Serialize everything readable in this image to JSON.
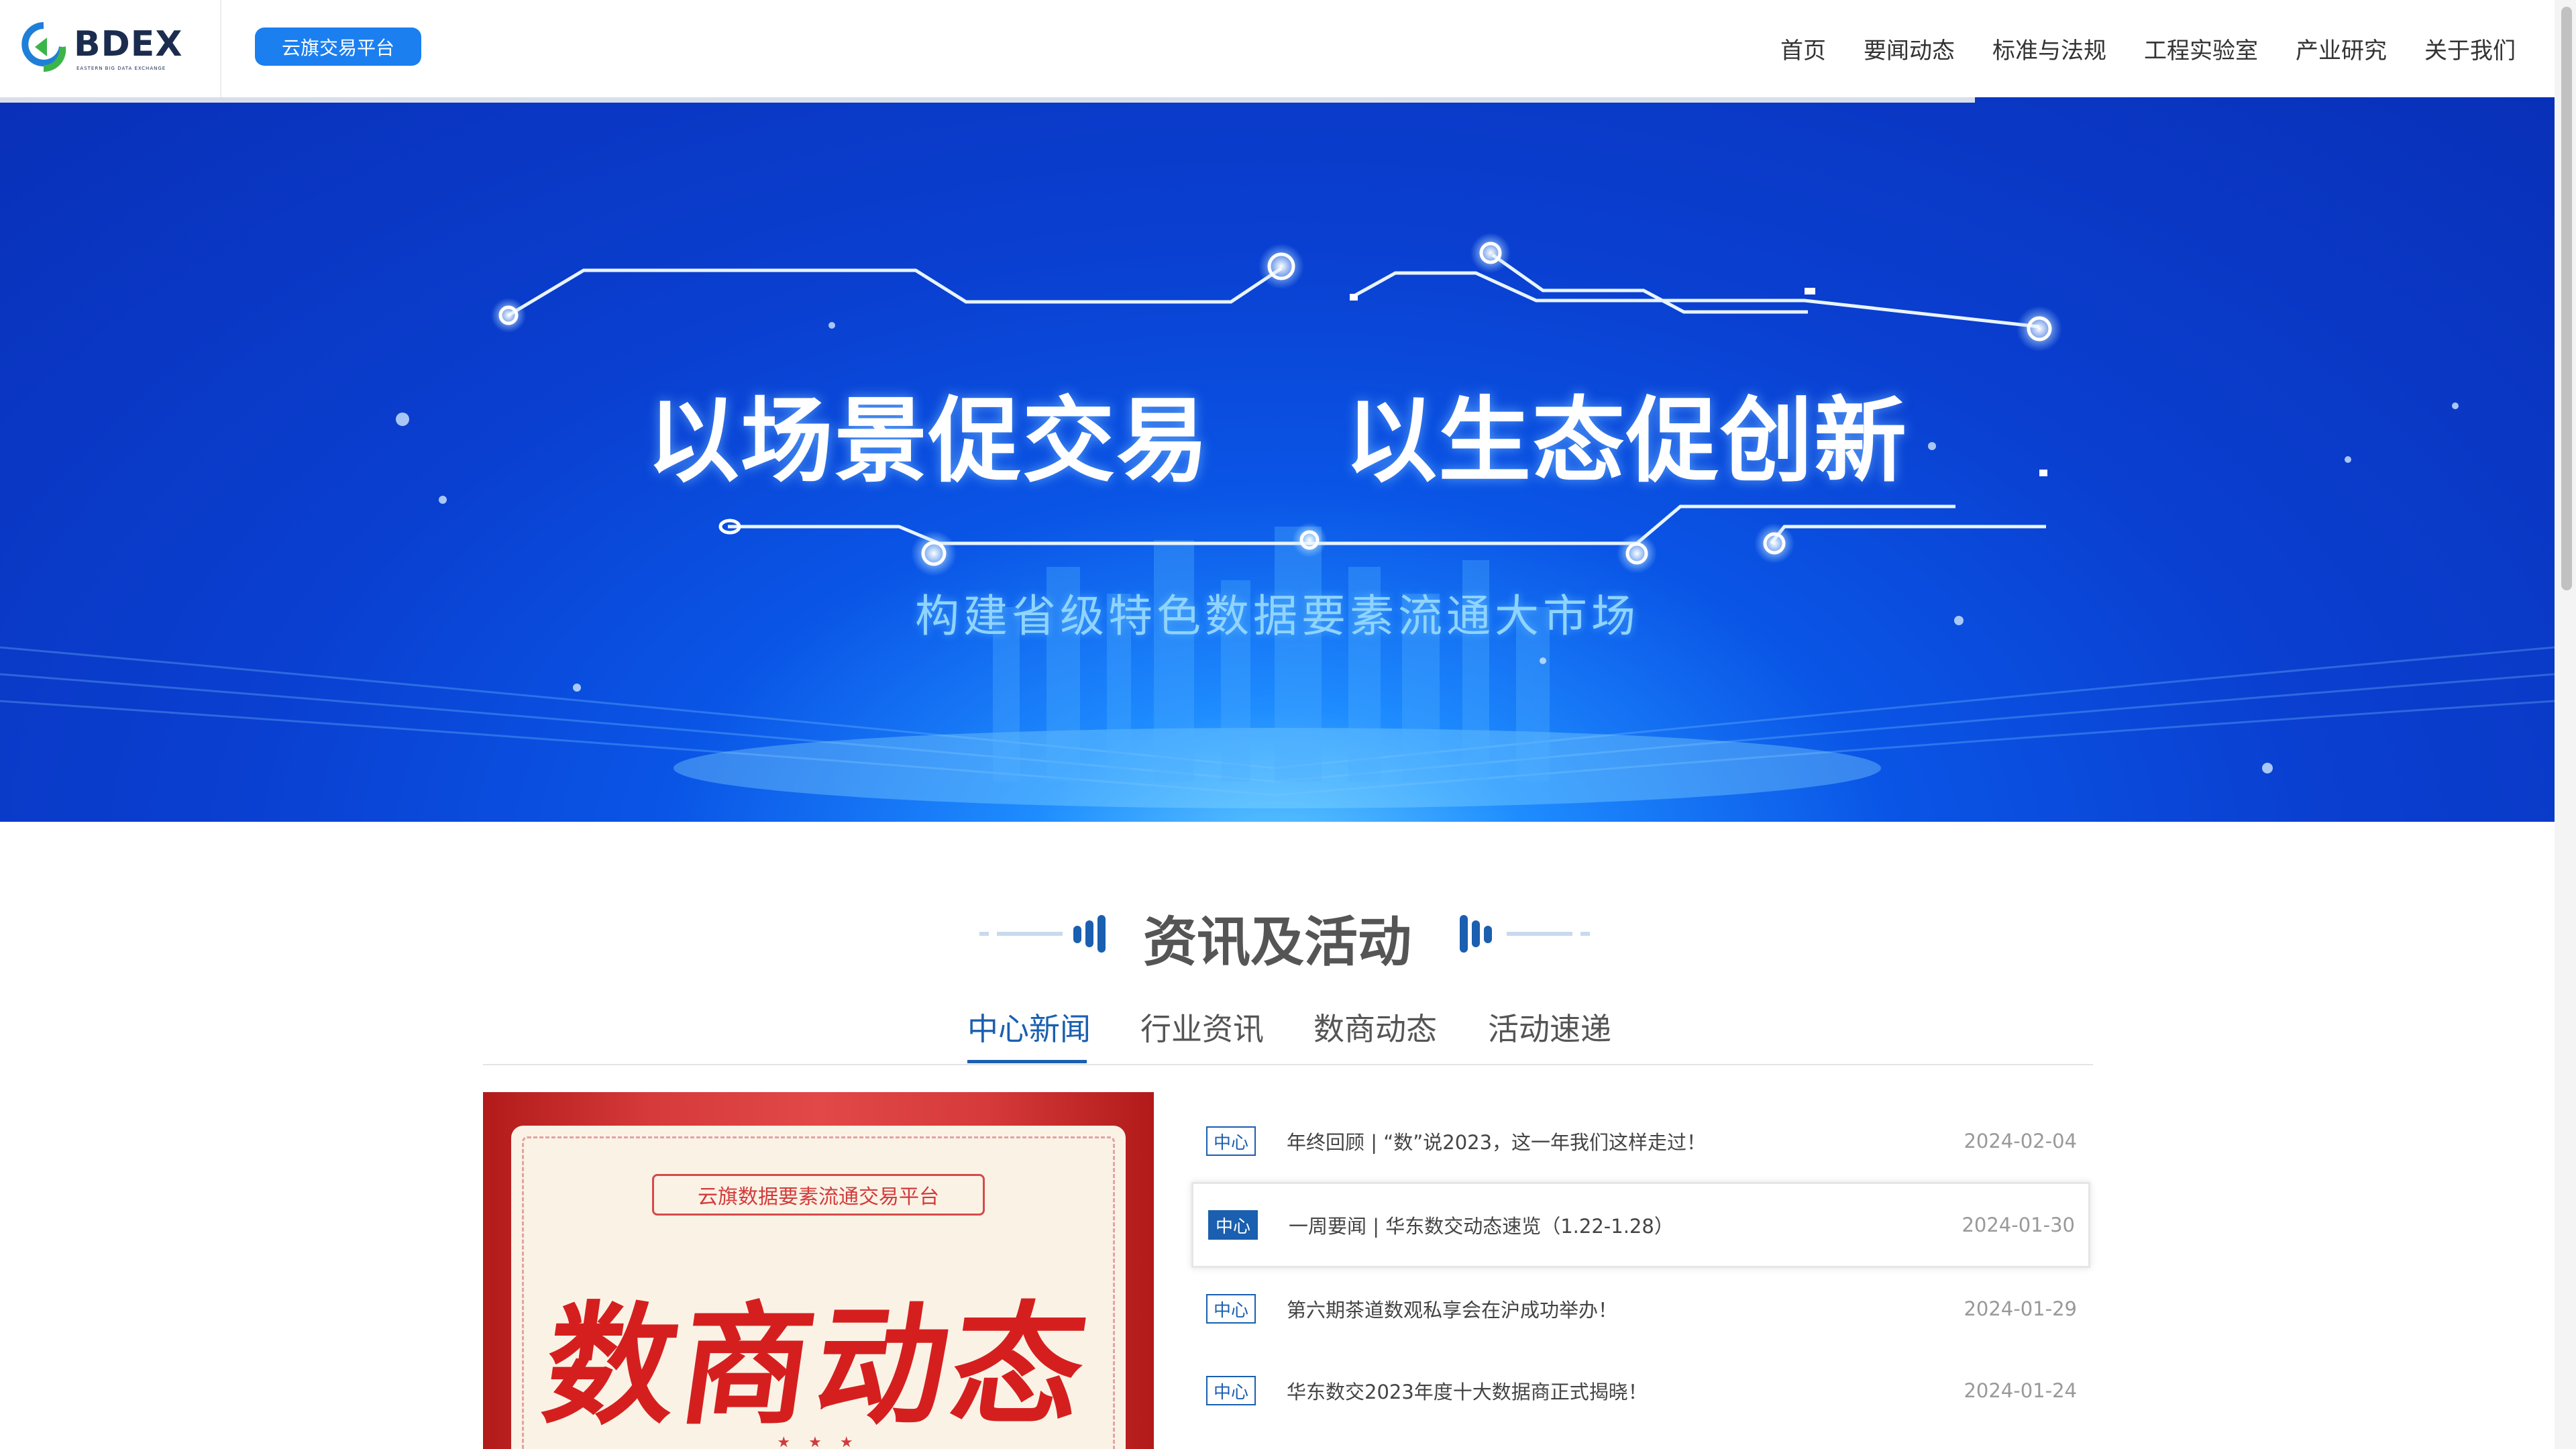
{
  "header": {
    "logo_text": "BDEX",
    "logo_sub": "EASTERN BIG DATA EXCHANGE",
    "platform_button": "云旗交易平台",
    "nav": [
      "首页",
      "要闻动态",
      "标准与法规",
      "工程实验室",
      "产业研究",
      "关于我们"
    ]
  },
  "banner": {
    "title": "以场景促交易    以生态促创新",
    "subtitle": "构建省级特色数据要素流通大市场"
  },
  "news_section": {
    "title": "资讯及活动",
    "tabs": [
      "中心新闻",
      "行业资讯",
      "数商动态",
      "活动速递"
    ],
    "active_tab": "中心新闻",
    "image_card": {
      "label": "云旗数据要素流通交易平台",
      "big_text": "数商动态",
      "stars": "★ ★ ★"
    },
    "items": [
      {
        "badge": "中心",
        "title": "年终回顾 | “数”说2023，这一年我们这样走过！",
        "date": "2024-02-04"
      },
      {
        "badge": "中心",
        "title": "一周要闻 | 华东数交动态速览（1.22-1.28）",
        "date": "2024-01-30"
      },
      {
        "badge": "中心",
        "title": "第六期茶道数观私享会在沪成功举办！",
        "date": "2024-01-29"
      },
      {
        "badge": "中心",
        "title": "华东数交2023年度十大数据商正式揭晓！",
        "date": "2024-01-24"
      }
    ]
  },
  "colors": {
    "accent": "#1a5fb0",
    "button_blue": "#1b7ff0",
    "banner_blue": "#0a3fd0"
  }
}
